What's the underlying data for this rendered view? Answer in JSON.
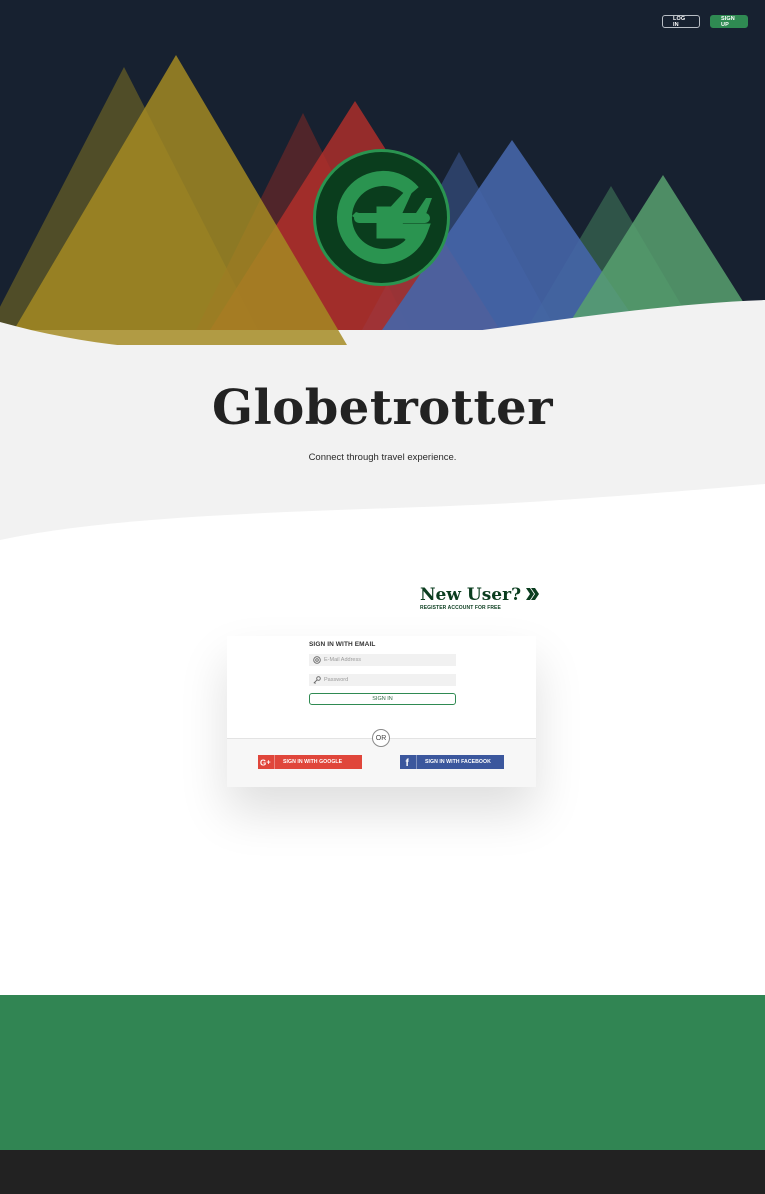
{
  "nav": {
    "login_label": "LOG IN",
    "signup_label": "SIGN UP"
  },
  "brand": {
    "title": "Globetrotter",
    "tagline": "Connect through travel experience."
  },
  "register": {
    "title": "New User?",
    "subtitle": "REGISTER ACCOUNT FOR FREE"
  },
  "signin": {
    "heading": "SIGN IN WITH EMAIL",
    "email_placeholder": "E-Mail Address",
    "password_placeholder": "Password",
    "button_label": "SIGN IN",
    "divider_label": "OR"
  },
  "social": {
    "google_label": "SIGN IN WITH GOOGLE",
    "facebook_label": "SIGN IN WITH FACEBOOK"
  },
  "colors": {
    "night_sky": "#172130",
    "brand_green": "#2f8a52",
    "dark_green": "#0b3d1f",
    "google_red": "#e0463b",
    "facebook_blue": "#3b579d",
    "footer_green": "#318553",
    "footer_dark": "#222222"
  },
  "icons": {
    "logo": "globe-plane-logo-icon",
    "email": "at-sign-icon",
    "password": "key-icon",
    "google": "google-plus-icon",
    "facebook": "facebook-icon",
    "register_arrow": "double-chevron-right-icon"
  }
}
